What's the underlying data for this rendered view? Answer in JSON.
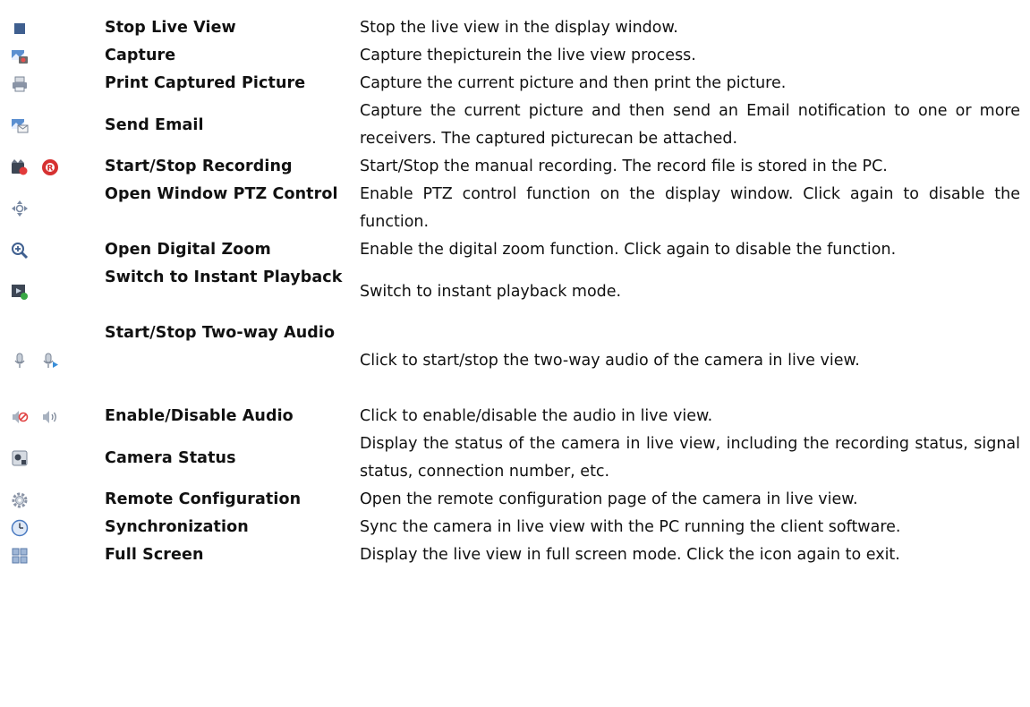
{
  "rows": [
    {
      "name": "Stop Live View",
      "desc": "Stop the live view in the display window.",
      "icons": [
        "stop-icon"
      ]
    },
    {
      "name": "Capture",
      "desc": "Capture thepicturein the live view process.",
      "icons": [
        "capture-icon"
      ]
    },
    {
      "name": "Print Captured Picture",
      "desc": "Capture the current picture and then print the picture.",
      "icons": [
        "printer-icon"
      ]
    },
    {
      "name": "Send Email",
      "desc": "Capture the current picture and then send an Email notification to one or more receivers. The captured picturecan be attached.",
      "icons": [
        "email-icon"
      ]
    },
    {
      "name": "Start/Stop Recording",
      "desc": "Start/Stop the manual recording. The record file is stored in the PC.",
      "icons": [
        "record-start-icon",
        "record-stop-icon"
      ]
    },
    {
      "name": "Open Window PTZ Control",
      "desc": "Enable PTZ control function on the display window. Click again to disable the function.",
      "icons": [
        "ptz-icon"
      ]
    },
    {
      "name": "Open Digital Zoom",
      "desc": "Enable the digital zoom function. Click again to disable the function.",
      "icons": [
        "zoom-icon"
      ]
    },
    {
      "name": "Switch to Instant Playback",
      "desc": "Switch to instant playback mode.",
      "icons": [
        "instant-playback-icon"
      ]
    },
    {
      "name": "Start/Stop Two-way Audio",
      "desc": "Click to start/stop the two-way audio of the camera in live view.",
      "icons": [
        "microphone-icon",
        "microphone-active-icon"
      ]
    },
    {
      "name": "Enable/Disable Audio",
      "desc": "Click to enable/disable the audio in live view.",
      "icons": [
        "speaker-muted-icon",
        "speaker-icon"
      ]
    },
    {
      "name": "Camera Status",
      "desc": "Display the status of the camera in live view, including the recording status, signal status, connection number, etc.",
      "icons": [
        "camera-status-icon"
      ]
    },
    {
      "name": "Remote Configuration",
      "desc": "Open the remote configuration page of the camera in live view.",
      "icons": [
        "gear-icon"
      ]
    },
    {
      "name": "Synchronization",
      "desc": "Sync the camera in live view with the PC running the client software.",
      "icons": [
        "clock-icon"
      ]
    },
    {
      "name": "Full Screen",
      "desc": "Display the live view in full screen mode. Click the icon again to exit.",
      "icons": [
        "fullscreen-icon"
      ]
    }
  ]
}
